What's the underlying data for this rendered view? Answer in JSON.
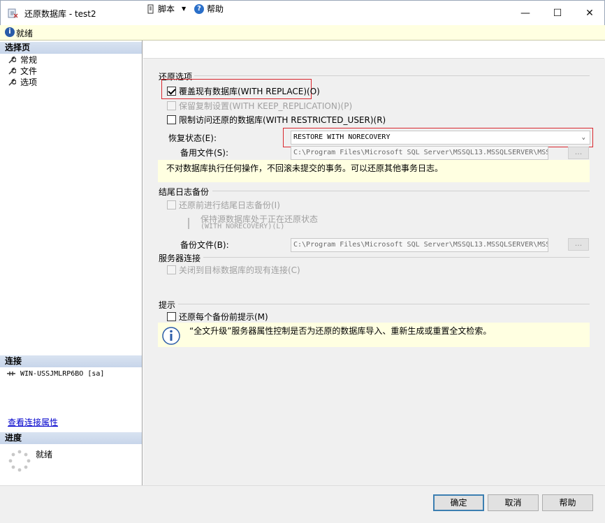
{
  "window": {
    "title": "还原数据库 - test2",
    "minimize_glyph": "—",
    "maximize_glyph": "☐",
    "close_glyph": "✕"
  },
  "status": {
    "text": "就绪",
    "icon": "info-icon"
  },
  "left": {
    "select_page_header": "选择页",
    "pages": [
      {
        "label": "常规"
      },
      {
        "label": "文件"
      },
      {
        "label": "选项"
      }
    ],
    "connection_header": "连接",
    "connection_name": "WIN-USSJMLRP6BO [sa]",
    "view_connection_link": "查看连接属性",
    "progress_header": "进度",
    "progress_status": "就绪"
  },
  "toolbar": {
    "script_label": "脚本",
    "help_label": "帮助"
  },
  "restore_options": {
    "title": "还原选项",
    "overwrite": {
      "label": "覆盖现有数据库(WITH REPLACE)(O)",
      "checked": true
    },
    "keep_replication": {
      "label": "保留复制设置(WITH KEEP_REPLICATION)(P)",
      "checked": false,
      "disabled": true
    },
    "restrict_access": {
      "label": "限制访问还原的数据库(WITH RESTRICTED_USER)(R)",
      "checked": false
    },
    "recovery_state_label": "恢复状态(E):",
    "recovery_state_value": "RESTORE WITH NORECOVERY",
    "standby_file_label": "备用文件(S):",
    "standby_file_value": "C:\\Program Files\\Microsoft SQL Server\\MSSQL13.MSSQLSERVER\\MSS",
    "ellipsis": "...",
    "description": "不对数据库执行任何操作，不回滚未提交的事务。可以还原其他事务日志。"
  },
  "tail_log": {
    "title": "结尾日志备份",
    "take_tail_log": {
      "label": "还原前进行结尾日志备份(I)",
      "disabled": true
    },
    "leave_restoring_line1": "保持源数据库处于正在还原状态",
    "leave_restoring_line2": "(WITH NORECOVERY)(L)",
    "backup_file_label": "备份文件(B):",
    "backup_file_value": "C:\\Program Files\\Microsoft SQL Server\\MSSQL13.MSSQLSERVER\\MSS",
    "ellipsis": "..."
  },
  "server_connections": {
    "title": "服务器连接",
    "close_connections": {
      "label": "关闭到目标数据库的现有连接(C)",
      "disabled": true
    }
  },
  "prompt": {
    "title": "提示",
    "prompt_before_each": {
      "label": "还原每个备份前提示(M)",
      "checked": false
    },
    "info_text": "“全文升级”服务器属性控制是否为还原的数据库导入、重新生成或重置全文检索。"
  },
  "buttons": {
    "ok": "确定",
    "cancel": "取消",
    "help": "帮助"
  },
  "colors": {
    "status_bg": "#ffffe1",
    "highlight": "#d9272e",
    "primary_border": "#3c7fb1",
    "link": "#0000cc"
  }
}
